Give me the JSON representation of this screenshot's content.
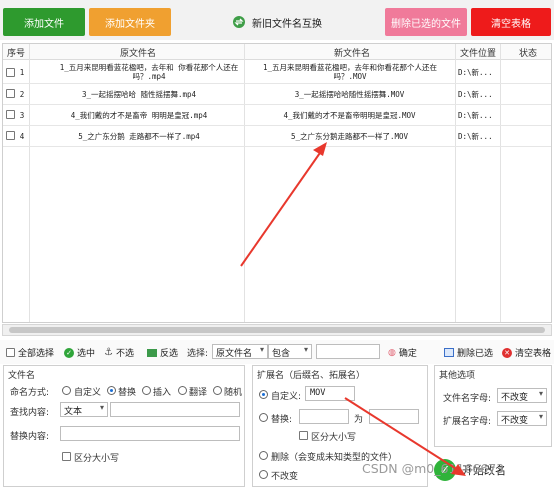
{
  "toolbar": {
    "add_file": "添加文件",
    "add_folder": "添加文件夹",
    "swap_names": "新旧文件名互换",
    "delete_selected": "删除已选的文件",
    "clear_table": "清空表格"
  },
  "colors": {
    "green": "#2e9a2e",
    "orange": "#f0a030",
    "pink": "#f07a9a",
    "red": "#ee1b1b",
    "arrow": "#e8382d"
  },
  "table": {
    "headers": [
      "序号",
      "原文件名",
      "新文件名",
      "文件位置",
      "状态"
    ],
    "rows": [
      {
        "no": "1",
        "orig": "1_五月来昆明看蓝花楹吧，去年和  你看花那个人还在吗？.mp4",
        "new": "1_五月来昆明看蓝花楹吧，去年和你看花那个人还在吗？.MOV",
        "loc": "D:\\新..."
      },
      {
        "no": "2",
        "orig": "3_一起摇摆哈哈  随性摇摆舞.mp4",
        "new": "3_一起摇摆哈哈随性摇摆舞.MOV",
        "loc": "D:\\新..."
      },
      {
        "no": "3",
        "orig": "4_我们戴的才不是畜帝  明明是皇冠.mp4",
        "new": "4_我们戴的才不是畜帝明明是皇冠.MOV",
        "loc": "D:\\新..."
      },
      {
        "no": "4",
        "orig": "5_之广东分鹅  走路都不一样了.mp4",
        "new": "5_之广东分鹅走路都不一样了.MOV",
        "loc": "D:\\新..."
      }
    ]
  },
  "select_bar": {
    "select_all": "全部选择",
    "select_on": "选中",
    "select_off": "不选",
    "invert": "反选",
    "choose_label": "选择:",
    "choose_field": "原文件名",
    "match_mode": "包含",
    "match_value": "",
    "confirm": "确定",
    "delete_selected": "删除已选",
    "clear_table": "清空表格"
  },
  "filename_panel": {
    "title": "文件名",
    "naming_label": "命名方式:",
    "options": [
      "自定义",
      "替换",
      "插入",
      "翻译",
      "随机"
    ],
    "selected": "替换",
    "find_label": "查找内容:",
    "find_type": "文本",
    "find_value": "",
    "replace_label": "替换内容:",
    "replace_value": "",
    "case_label": "区分大小写"
  },
  "ext_panel": {
    "title": "扩展名（后缀名、拓展名）",
    "custom_label": "自定义:",
    "custom_value": "MOV",
    "replace_label": "替换:",
    "replace_from": "",
    "to_label": "为",
    "replace_to": "",
    "case_label": "区分大小写",
    "delete_label": "删除（会变成未知类型的文件）",
    "keep_label": "不改变"
  },
  "other_panel": {
    "title": "其他选项",
    "filename_case_label": "文件名字母:",
    "filename_case_value": "不改变",
    "ext_case_label": "扩展名字母:",
    "ext_case_value": "不改变"
  },
  "start_button": "开始改名",
  "watermark": "CSDN @m0_61166673"
}
